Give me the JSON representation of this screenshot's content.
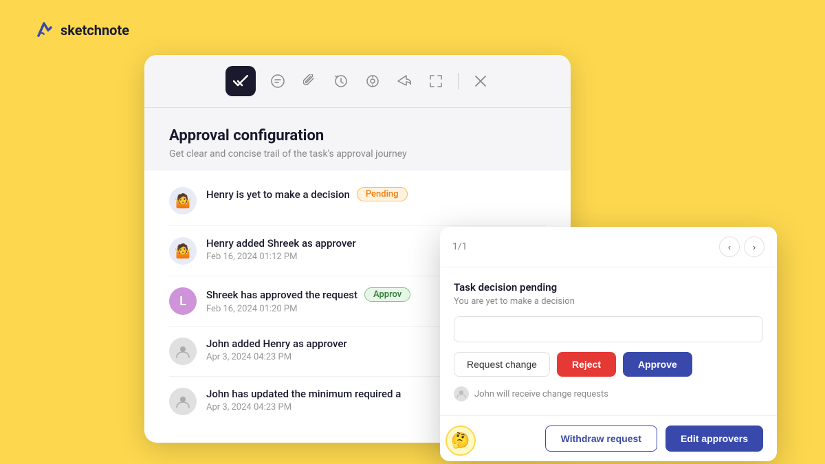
{
  "logo": {
    "text": "sketchnote"
  },
  "main_panel": {
    "title": "Approval configuration",
    "subtitle": "Get clear and concise trail of the task's approval journey",
    "toolbar_icons": [
      "✓",
      "○",
      "⊘",
      "◷",
      "◎",
      "↪",
      "⤢",
      "×"
    ],
    "items": [
      {
        "avatar_type": "emoji",
        "avatar_emoji": "🤷",
        "text": "Henry is yet to make a decision",
        "badge": "Pending",
        "badge_type": "pending",
        "date": ""
      },
      {
        "avatar_type": "emoji",
        "avatar_emoji": "🤷",
        "text": "Henry added Shreek as approver",
        "badge": "",
        "date": "Feb 16, 2024 01:12 PM"
      },
      {
        "avatar_type": "letter",
        "avatar_letter": "L",
        "text": "Shreek has approved the request",
        "badge": "Approv",
        "badge_type": "approved",
        "date": "Feb 16, 2024 01:20 PM"
      },
      {
        "avatar_type": "grey",
        "text": "John added Henry as approver",
        "badge": "",
        "date": "Apr 3, 2024 04:23 PM"
      },
      {
        "avatar_type": "grey",
        "text": "John has updated the minimum required a",
        "badge": "",
        "date": "Apr 3, 2024 04:23 PM"
      }
    ]
  },
  "popup": {
    "page_indicator": "1/1",
    "alert_title": "Task decision pending",
    "alert_subtitle": "You are yet to make a decision",
    "input_placeholder": "",
    "btn_request_change": "Request change",
    "btn_reject": "Reject",
    "btn_approve": "Approve",
    "footer_note": "John will receive change requests",
    "btn_withdraw": "Withdraw request",
    "btn_edit_approvers": "Edit approvers"
  }
}
